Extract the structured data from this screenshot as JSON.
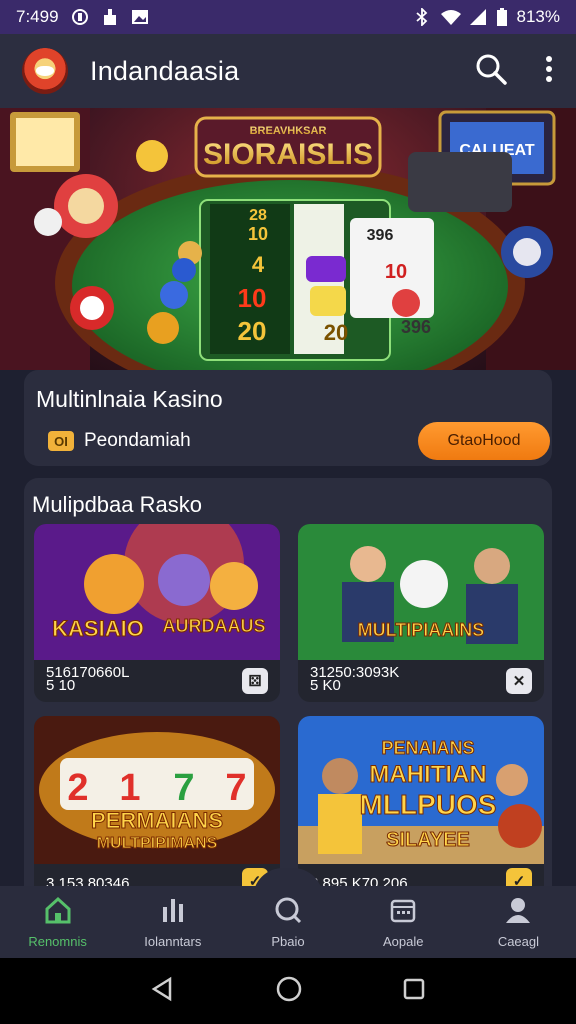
{
  "status_bar": {
    "time": "7:499",
    "battery": "813%"
  },
  "app_bar": {
    "title": "Indandaasia",
    "icons": [
      "search-icon",
      "more-vert-icon"
    ]
  },
  "hero": {
    "banner_small": "BREAVHKSAR",
    "banner_main": "SIORAISLIS",
    "cabinet_sign": "CALUEAT",
    "grid": [
      "28",
      "10",
      "4",
      "10",
      "20",
      "396",
      "10",
      "20",
      "396"
    ]
  },
  "featured": {
    "title": "Multinlnaia Kasino",
    "subtitle": "Peondamiah",
    "subtitle_icon": "OI",
    "cta": "GtaoHood"
  },
  "games_section": {
    "title": "Mulipdbaa Rasko",
    "games": [
      {
        "art_title": "KASIAIO",
        "art_title2": "AURDAAUS",
        "meta": "516170660L",
        "meta2": "5 10",
        "badge_icon": "dice-icon"
      },
      {
        "art_title": "MULTIPIAAINS",
        "meta": "31250:3093K",
        "meta2": "5 K0",
        "badge_icon": "close-icon"
      },
      {
        "art_title": "PERMAIANS",
        "art_title2": "MULTPIPIMANS",
        "reels": [
          "2",
          "1",
          "7",
          "7"
        ],
        "meta": "3 153 80346",
        "badge_icon": "check-icon"
      },
      {
        "art_title": "PENAIANS",
        "art_title2": "MAHITIAN",
        "art_title3": "MLLPUOS",
        "art_title4": "SILAYEE",
        "meta": "3 895 K70 206",
        "badge_icon": "check-icon"
      }
    ]
  },
  "bottom_nav": [
    {
      "label": "Renomnis",
      "icon": "home-icon",
      "active": true
    },
    {
      "label": "Iolanntars",
      "icon": "chart-icon",
      "active": false
    },
    {
      "label": "Pbaio",
      "icon": "search-icon",
      "active": false
    },
    {
      "label": "Aopale",
      "icon": "calendar-icon",
      "active": false
    },
    {
      "label": "Caeagl",
      "icon": "user-icon",
      "active": false
    }
  ],
  "colors": {
    "accent": "#56c06a",
    "cta": "#f58a1f",
    "surface": "#2b2d3e"
  }
}
